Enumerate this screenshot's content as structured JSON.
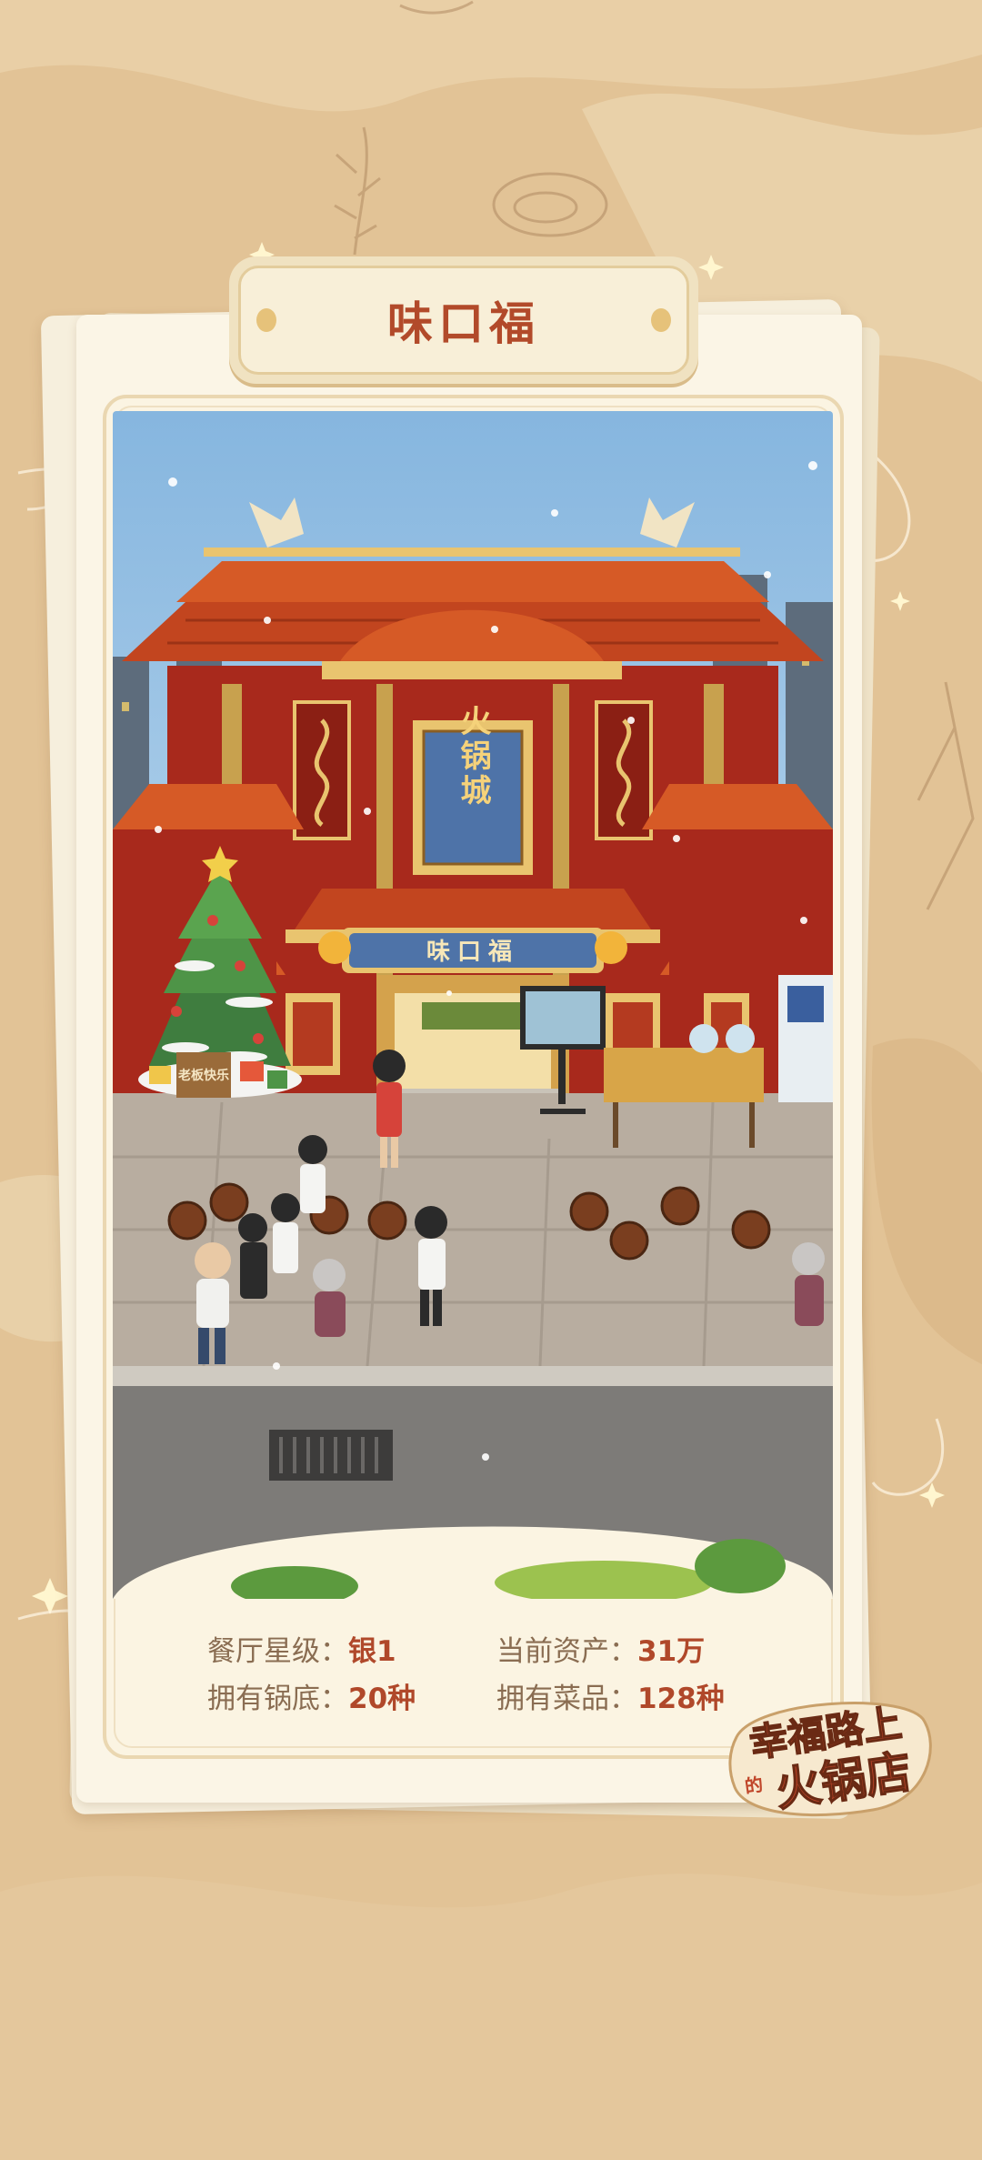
{
  "restaurant": {
    "name": "味口福"
  },
  "scene": {
    "building_sign": "火锅城",
    "door_sign": "味口福",
    "tree_board": "老板快乐"
  },
  "stats": [
    {
      "label": "餐厅星级：",
      "value": "银1"
    },
    {
      "label": "当前资产：",
      "value": "31万"
    },
    {
      "label": "拥有锅底：",
      "value": "20种"
    },
    {
      "label": "拥有菜品：",
      "value": "128种"
    }
  ],
  "logo": {
    "text": "幸福路上的火锅店"
  },
  "colors": {
    "background": "#e2c396",
    "card": "#fbf5e6",
    "title": "#b24a2a",
    "value": "#b0482a",
    "label": "#8a6d52"
  }
}
